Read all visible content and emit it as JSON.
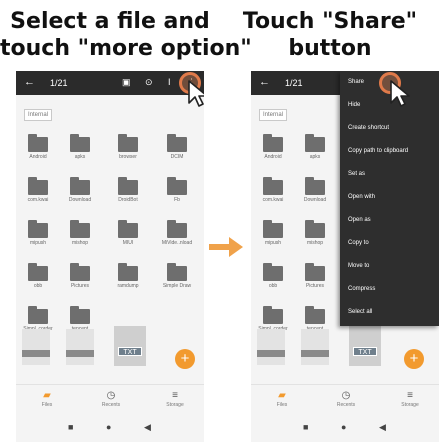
{
  "captions": {
    "left": [
      "Select a file and",
      "touch \"more option\""
    ],
    "right": [
      "Touch \"Share\"",
      "button"
    ]
  },
  "toolbar": {
    "back": "←",
    "count": "1/21",
    "icons": [
      "▣",
      "⊙",
      "I",
      "⋮"
    ]
  },
  "location_tag": "Internal",
  "folders": [
    [
      "Android",
      "apks",
      "browser",
      "DCIM"
    ],
    [
      "com.kwai",
      "Download",
      "DroidBot",
      "Fb"
    ],
    [
      "mipush",
      "mishop",
      "MIUI",
      "MiVide..nload"
    ],
    [
      "obb",
      "Pictures",
      "ramdump",
      "Simple Draw"
    ],
    [
      "Simpl..corder",
      "tencent",
      "",
      ""
    ]
  ],
  "files": {
    "txt_label": "TXT",
    "fab_label": "+"
  },
  "bottom_nav": [
    {
      "icon": "▰",
      "label": "Files",
      "active": true
    },
    {
      "icon": "◷",
      "label": "Recents",
      "active": false
    },
    {
      "icon": "≡",
      "label": "Storage",
      "active": false
    }
  ],
  "system_nav": [
    "■",
    "●",
    "◀"
  ],
  "menu": [
    "Share",
    "Hide",
    "Create shortcut",
    "Copy path to clipboard",
    "Set as",
    "Open with",
    "Open as",
    "Copy to",
    "Move to",
    "Compress",
    "Select all"
  ],
  "colors": {
    "accent": "#f29a2e",
    "highlight": "#e07a4a",
    "arrow": "#f0a24a",
    "toolbar": "#2b2b2b",
    "menu": "#2e2e2e"
  }
}
